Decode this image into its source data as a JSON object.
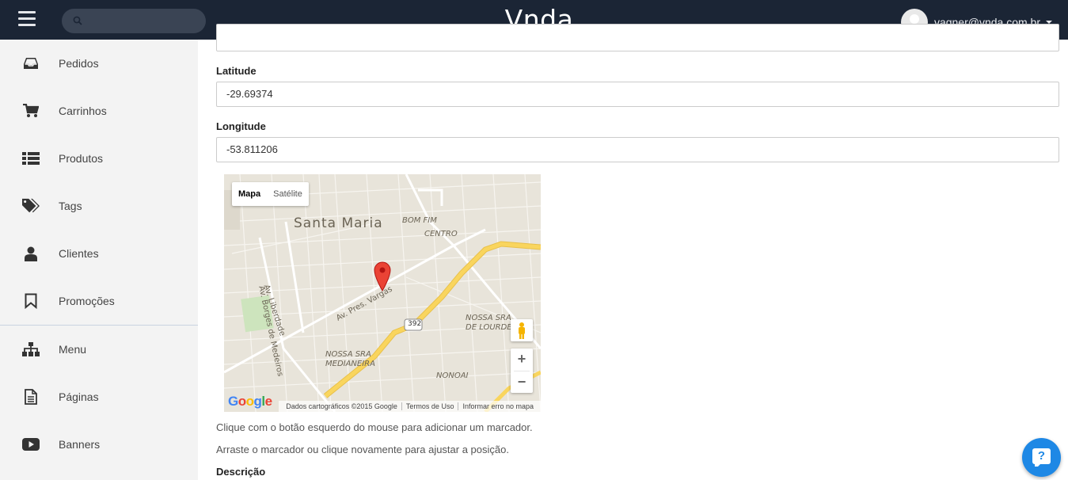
{
  "header": {
    "brand": "Vnda",
    "search_placeholder": "",
    "user_email": "vagner@vnda.com.br",
    "background_color": "#1b2535"
  },
  "sidebar": {
    "items": [
      {
        "label": "Pedidos",
        "icon": "inbox-icon"
      },
      {
        "label": "Carrinhos",
        "icon": "cart-icon"
      },
      {
        "label": "Produtos",
        "icon": "list-icon"
      },
      {
        "label": "Tags",
        "icon": "tags-icon"
      },
      {
        "label": "Clientes",
        "icon": "user-icon"
      },
      {
        "label": "Promoções",
        "icon": "bookmark-icon"
      },
      {
        "label": "Menu",
        "icon": "sitemap-icon"
      },
      {
        "label": "Páginas",
        "icon": "file-icon"
      },
      {
        "label": "Banners",
        "icon": "youtube-play-icon"
      }
    ]
  },
  "form": {
    "latitude_label": "Latitude",
    "latitude_value": "-29.69374",
    "longitude_label": "Longitude",
    "longitude_value": "-53.811206",
    "help_1": "Clique com o botão esquerdo do mouse para adicionar um marcador.",
    "help_2": "Arraste o marcador ou clique novamente para ajustar a posição.",
    "description_label": "Descrição"
  },
  "map": {
    "type_buttons": [
      "Mapa",
      "Satélite"
    ],
    "active_type": "Mapa",
    "labels": {
      "city": "Santa Maria",
      "bom_fim": "BOM FIM",
      "centro": "CENTRO",
      "nossa_sra_lourdes": "NOSSA SRA",
      "de_lourdes": "DE LOURDE",
      "nossa_sra_medianeira": "NOSSA SRA",
      "medianeira": "MEDIANEIRA",
      "nonoai": "NONOAI",
      "av_borges": "Av. Borges de Medeiros",
      "av_liberdade": "Av. Liberdade",
      "av_pres_vargas": "Av. Pres. Vargas",
      "route": "392"
    },
    "zoom_in": "+",
    "zoom_out": "−",
    "attribution": {
      "data": "Dados cartográficos ©2015 Google",
      "terms": "Termos de Uso",
      "report": "Informar erro no mapa"
    },
    "google_logo": "Google"
  },
  "help_button": {
    "label": "?"
  }
}
